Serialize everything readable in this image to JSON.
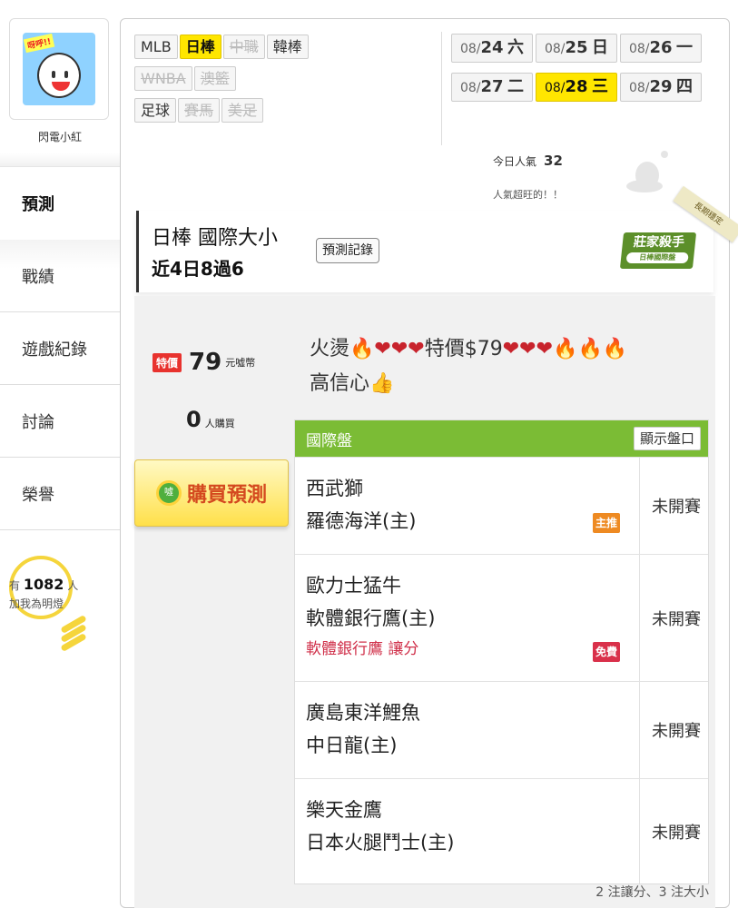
{
  "user": {
    "name": "閃電小紅",
    "avatar_text": "呀呼!!"
  },
  "nav": [
    {
      "label": "預測"
    },
    {
      "label": "戰績"
    },
    {
      "label": "遊戲紀錄"
    },
    {
      "label": "討論"
    },
    {
      "label": "榮譽"
    }
  ],
  "bulb": {
    "prefix": "有",
    "count": "1082",
    "suffix": "人",
    "line2": "加我為明燈"
  },
  "leagues": [
    {
      "label": "MLB",
      "state": "normal"
    },
    {
      "label": "日棒",
      "state": "selected"
    },
    {
      "label": "中職",
      "state": "disabled"
    },
    {
      "label": "韓棒",
      "state": "normal"
    },
    {
      "label": "WNBA",
      "state": "disabled"
    },
    {
      "label": "澳籃",
      "state": "disabled"
    },
    {
      "label": "足球",
      "state": "normal"
    },
    {
      "label": "賽馬",
      "state": "disabled"
    },
    {
      "label": "美足",
      "state": "disabled"
    }
  ],
  "dates": [
    {
      "month": "08/",
      "day": "24",
      "weekday": "六",
      "selected": false
    },
    {
      "month": "08/",
      "day": "25",
      "weekday": "日",
      "selected": false
    },
    {
      "month": "08/",
      "day": "26",
      "weekday": "一",
      "selected": false
    },
    {
      "month": "08/",
      "day": "27",
      "weekday": "二",
      "selected": false
    },
    {
      "month": "08/",
      "day": "28",
      "weekday": "三",
      "selected": true
    },
    {
      "month": "08/",
      "day": "29",
      "weekday": "四",
      "selected": false
    }
  ],
  "popularity": {
    "label": "今日人氣",
    "value": "32",
    "note": "人氣超旺的！！"
  },
  "header": {
    "title": "日棒 國際大小",
    "subtitle": "近4日8過6",
    "record_button": "預測記錄",
    "badge_title": "莊家殺手",
    "badge_sub": "日棒國際盤",
    "ribbon": "長期穩定"
  },
  "offer": {
    "sale_tag": "特價",
    "price": "79",
    "unit": "元噓幣",
    "buyers": "0",
    "buyers_unit": "人購買",
    "buy_button": "購買預測",
    "coin_text": "噓"
  },
  "promo": {
    "line1_prefix": "火燙",
    "line1_text": "特價$79",
    "line2": "高信心"
  },
  "table": {
    "header": "國際盤",
    "show_button": "顯示盤口",
    "rows": [
      {
        "team1": "西武獅",
        "team2": "羅德海洋(主)",
        "extra": "",
        "chip": "主推",
        "chip_color": "#ee8a22",
        "status": "未開賽"
      },
      {
        "team1": "歐力士猛牛",
        "team2": "軟體銀行鷹(主)",
        "extra": "軟體銀行鷹 讓分",
        "chip": "免費",
        "chip_color": "#d9304a",
        "status": "未開賽"
      },
      {
        "team1": "廣島東洋鯉魚",
        "team2": "中日龍(主)",
        "extra": "",
        "chip": "",
        "chip_color": "",
        "status": "未開賽"
      },
      {
        "team1": "樂天金鷹",
        "team2": "日本火腿鬥士(主)",
        "extra": "",
        "chip": "",
        "chip_color": "",
        "status": "未開賽"
      }
    ]
  },
  "footer_note": "2 注讓分、3 注大小",
  "colors": {
    "accent_yellow": "#ffe600",
    "header_green": "#7bbc35",
    "sale_red": "#e8322e",
    "buy_orange": "#d4491f"
  }
}
